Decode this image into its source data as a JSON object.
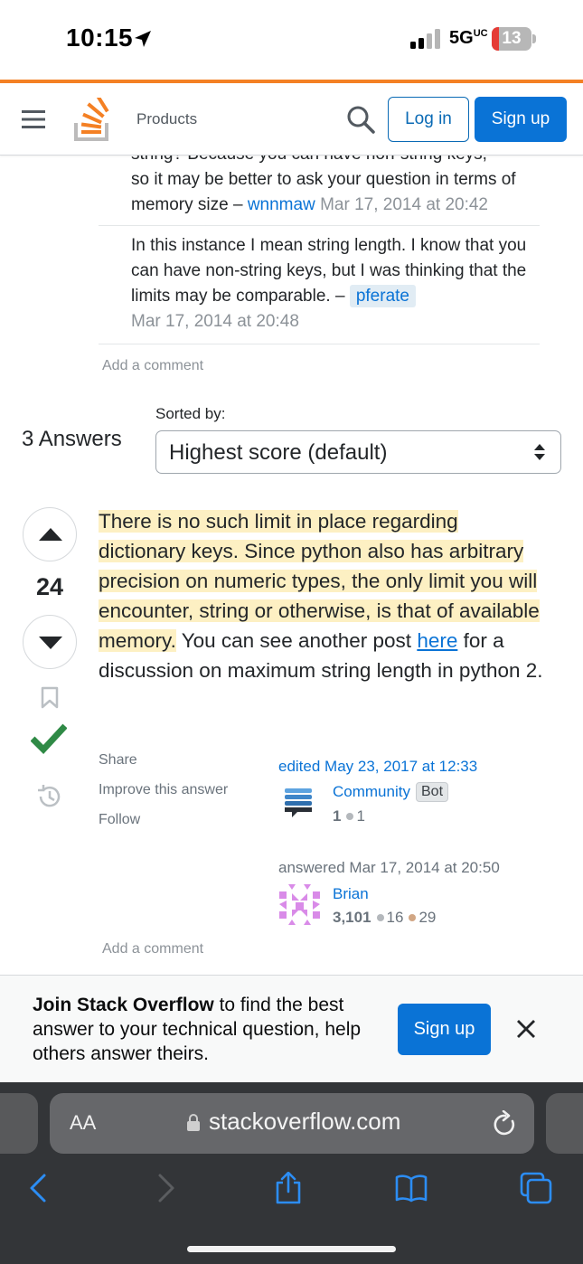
{
  "status_bar": {
    "time": "10:15",
    "network": "5G",
    "network_sup": "UC",
    "battery": "13"
  },
  "header": {
    "products_label": "Products",
    "login_label": "Log in",
    "signup_label": "Sign up"
  },
  "comments": [
    {
      "text_partial": "string? Because you can have non-string keys,",
      "text": "so it may be better to ask your question in terms of memory size –",
      "user": "wnnmaw",
      "date": "Mar 17, 2014 at 20:42"
    },
    {
      "text": "In this instance I mean string length. I know that you can have non-string keys, but I was thinking that the limits may be comparable. –",
      "user": "pferate",
      "date": "Mar 17, 2014 at 20:48"
    }
  ],
  "add_comment_label": "Add a comment",
  "answers_header": {
    "count_label": "3 Answers",
    "sorted_by_label": "Sorted by:",
    "sort_value": "Highest score (default)"
  },
  "answer": {
    "score": "24",
    "body_highlight": "There is no such limit in place regarding dictionary keys. Since python also has arbitrary precision on numeric types, the only limit you will encounter, string or otherwise, is that of available memory.",
    "body_rest_1": " You can see another post ",
    "link_text": "here",
    "body_rest_2": " for a discussion on maximum string length in python 2.",
    "menu": {
      "share": "Share",
      "improve": "Improve this answer",
      "follow": "Follow"
    },
    "edited": {
      "label": "edited May 23, 2017 at 12:33",
      "user": "Community",
      "badge": "Bot",
      "reputation": "1",
      "silver": "1"
    },
    "answered": {
      "label": "answered Mar 17, 2014 at 20:50",
      "user": "Brian",
      "reputation": "3,101",
      "silver": "16",
      "bronze": "29"
    }
  },
  "join_banner": {
    "bold": "Join Stack Overflow",
    "rest": " to find the best answer to your technical question, help others answer theirs.",
    "button": "Sign up"
  },
  "safari": {
    "aa_label": "AA",
    "url": "stackoverflow.com"
  },
  "colors": {
    "accent_orange": "#f48024",
    "link_blue": "#0a73d6",
    "highlight": "#fdf0c3",
    "accepted_green": "#2f8a46"
  }
}
